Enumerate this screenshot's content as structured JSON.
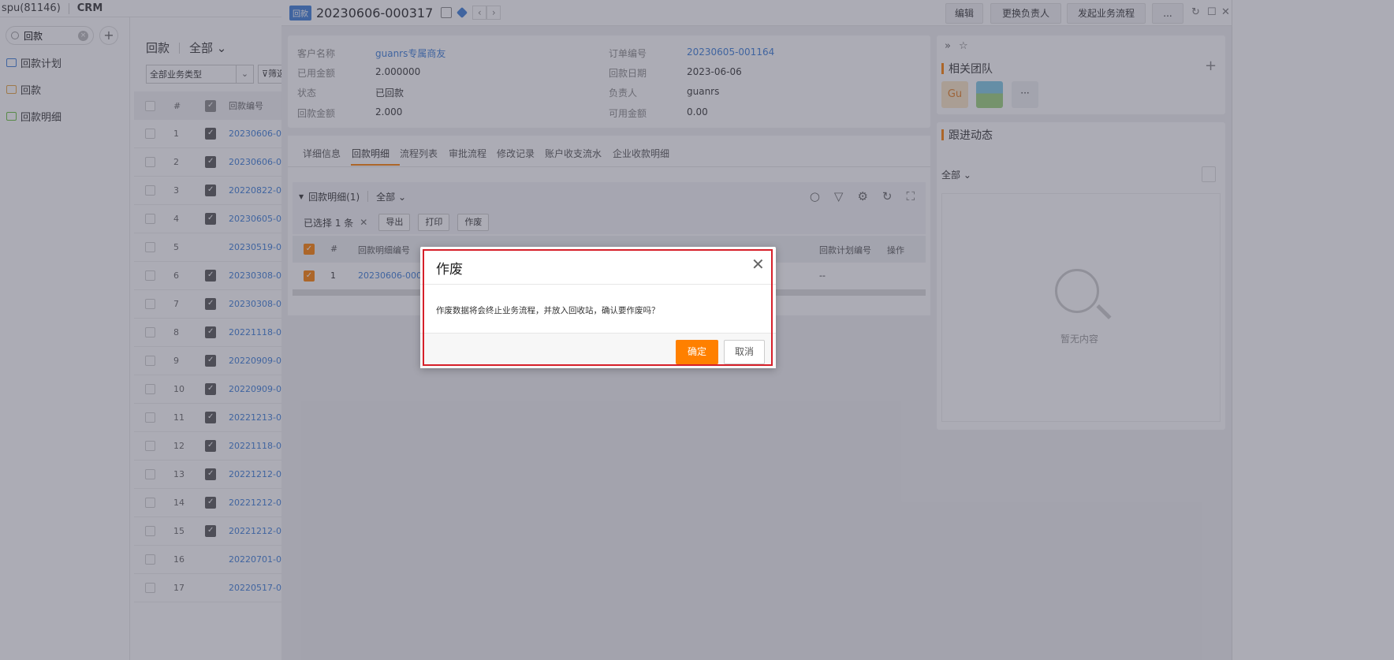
{
  "topbar": {
    "user": "spu(81146)",
    "app": "CRM"
  },
  "sidebar": {
    "search_value": "回款",
    "items": [
      {
        "label": "回款计划",
        "color": "#3b7dd8"
      },
      {
        "label": "回款",
        "color": "#e6a23c"
      },
      {
        "label": "回款明细",
        "color": "#67c23a"
      }
    ]
  },
  "list": {
    "title": "回款",
    "scope": "全部",
    "biz_type": "全部业务类型",
    "filter_label": "筛选",
    "col_num": "#",
    "col_code": "回款编号",
    "rows": [
      {
        "n": "1",
        "code": "20230606-0",
        "icon": true
      },
      {
        "n": "2",
        "code": "20230606-0",
        "icon": true
      },
      {
        "n": "3",
        "code": "20220822-0",
        "icon": true
      },
      {
        "n": "4",
        "code": "20230605-0",
        "icon": true
      },
      {
        "n": "5",
        "code": "20230519-0",
        "icon": false
      },
      {
        "n": "6",
        "code": "20230308-0",
        "icon": true
      },
      {
        "n": "7",
        "code": "20230308-0",
        "icon": true
      },
      {
        "n": "8",
        "code": "20221118-0",
        "icon": true
      },
      {
        "n": "9",
        "code": "20220909-0",
        "icon": true
      },
      {
        "n": "10",
        "code": "20220909-0",
        "icon": true
      },
      {
        "n": "11",
        "code": "20221213-0",
        "icon": true
      },
      {
        "n": "12",
        "code": "20221118-0",
        "icon": true
      },
      {
        "n": "13",
        "code": "20221212-0",
        "icon": true
      },
      {
        "n": "14",
        "code": "20221212-0",
        "icon": true
      },
      {
        "n": "15",
        "code": "20221212-0",
        "icon": true
      },
      {
        "n": "16",
        "code": "20220701-0",
        "icon": false
      },
      {
        "n": "17",
        "code": "20220517-0",
        "icon": false
      }
    ]
  },
  "detail": {
    "tag": "回款",
    "title": "20230606-000317",
    "buttons": {
      "edit": "编辑",
      "change_owner": "更换负责人",
      "start_flow": "发起业务流程",
      "more": "..."
    },
    "fields": {
      "customer_label": "客户名称",
      "customer_value": "guanrs专属商友",
      "used_label": "已用金额",
      "used_value": "2.000000",
      "status_label": "状态",
      "status_value": "已回款",
      "amount_label": "回款金额",
      "amount_value": "2.000",
      "order_label": "订单编号",
      "order_value": "20230605-001164",
      "date_label": "回款日期",
      "date_value": "2023-06-06",
      "owner_label": "负责人",
      "owner_value": "guanrs",
      "avail_label": "可用金额",
      "avail_value": "0.00"
    },
    "tabs": [
      "详细信息",
      "回款明细",
      "流程列表",
      "审批流程",
      "修改记录",
      "账户收支流水",
      "企业收款明细"
    ],
    "sub": {
      "title": "回款明细(1)",
      "scope": "全部",
      "selected": "已选择 1 条",
      "btn_export": "导出",
      "btn_print": "打印",
      "btn_void": "作废",
      "col_num": "#",
      "col_code": "回款明细编号",
      "col_plan": "回款计划编号",
      "col_op": "操作",
      "row_num": "1",
      "row_code": "20230606-00031",
      "row_plan": "--"
    },
    "team_title": "相关团队",
    "avatar_text": "Gu",
    "more_avatars": "···",
    "follow_title": "跟进动态",
    "follow_scope": "全部",
    "empty_text": "暂无内容"
  },
  "modal": {
    "title": "作废",
    "message": "作废数据将会终止业务流程，并放入回收站，确认要作废吗？",
    "ok": "确定",
    "cancel": "取消"
  }
}
